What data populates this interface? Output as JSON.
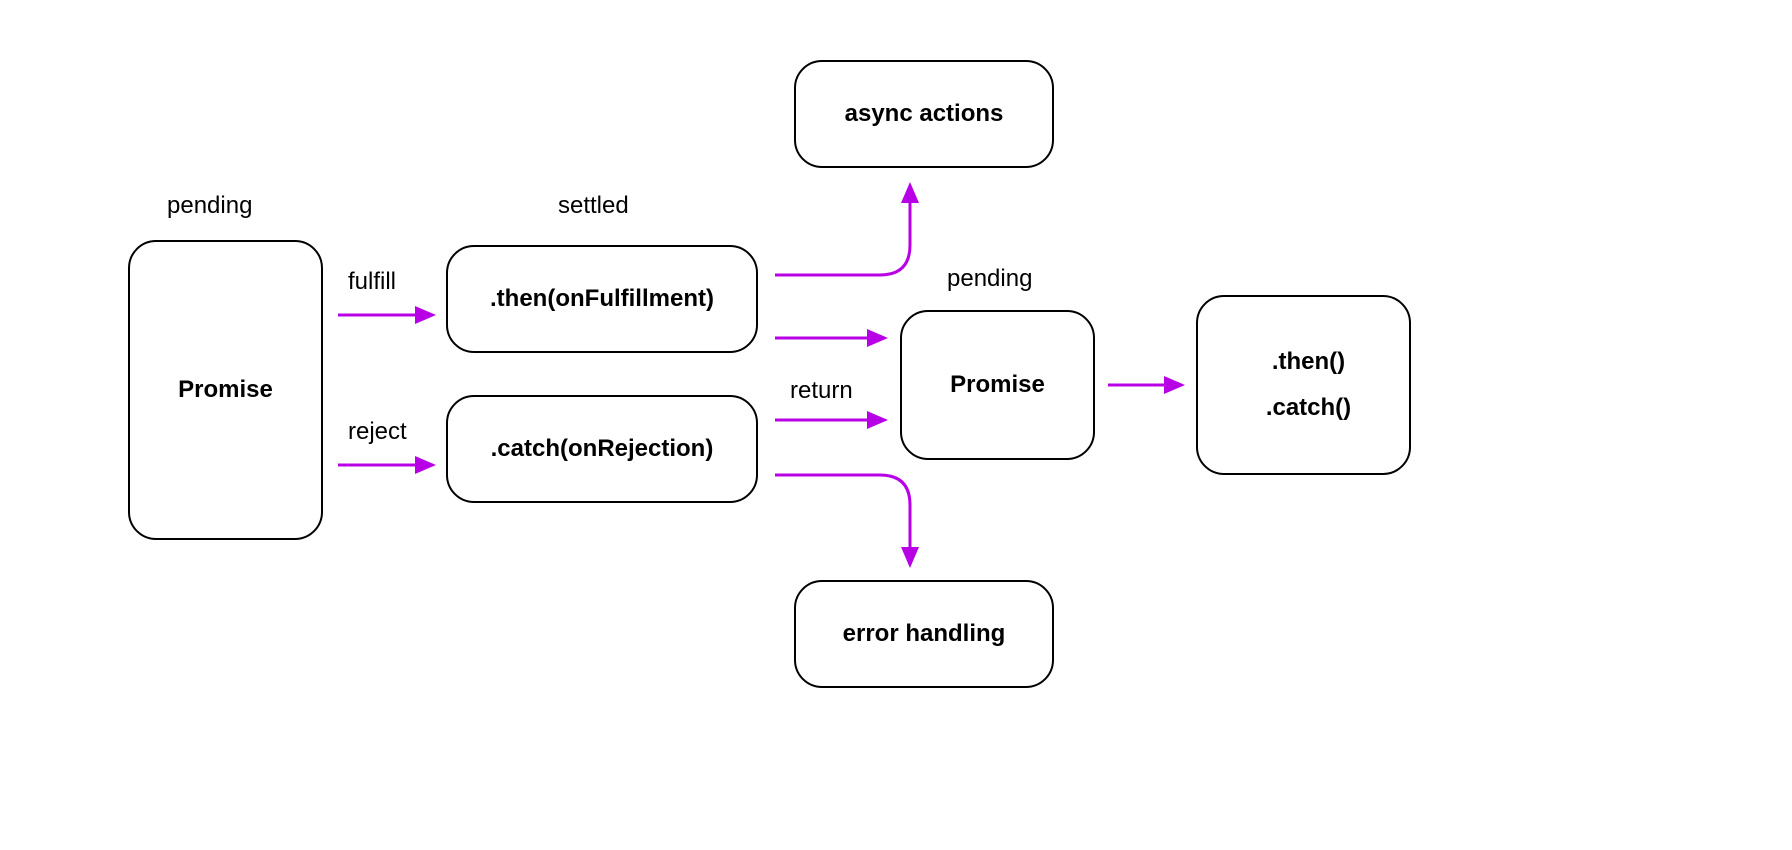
{
  "colors": {
    "arrow": "#b800e6"
  },
  "nodes": {
    "promise1": {
      "text": "Promise"
    },
    "then_fulfill": {
      "text": ".then(onFulfillment)"
    },
    "catch_reject": {
      "text": ".catch(onRejection)"
    },
    "async_actions": {
      "text": "async actions"
    },
    "error_handling": {
      "text": "error handling"
    },
    "promise2": {
      "text": "Promise"
    },
    "final_then": {
      "text": ".then()"
    },
    "final_catch": {
      "text": ".catch()"
    }
  },
  "labels": {
    "pending1": "pending",
    "settled": "settled",
    "fulfill": "fulfill",
    "reject": "reject",
    "return": "return",
    "pending2": "pending"
  }
}
